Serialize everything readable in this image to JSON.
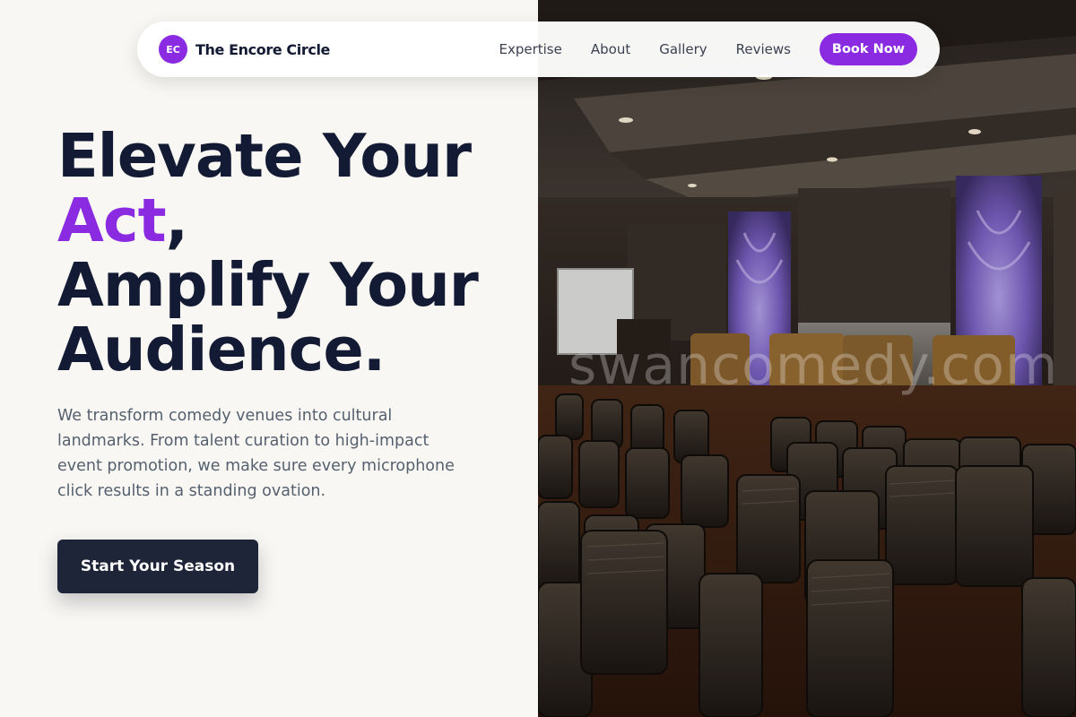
{
  "brand": {
    "initials": "EC",
    "name": "The Encore Circle",
    "accent_color": "#8a2be2"
  },
  "nav": {
    "links": [
      {
        "label": "Expertise"
      },
      {
        "label": "About"
      },
      {
        "label": "Gallery"
      },
      {
        "label": "Reviews"
      }
    ],
    "cta_label": "Book Now"
  },
  "hero": {
    "headline_line1": "Elevate Your",
    "headline_accent": "Act",
    "headline_comma": ",",
    "headline_line3": "Amplify Your",
    "headline_line4": "Audience.",
    "description": "We transform comedy venues into cultural landmarks. From talent curation to high-impact event promotion, we make sure every microphone click results in a standing ovation.",
    "cta_label": "Start Your Season",
    "image_watermark": "swancomedy.com"
  },
  "colors": {
    "heading": "#131a33",
    "accent": "#8a2be2",
    "body_text": "#55606f",
    "cta_bg": "#1e2538",
    "page_bg": "#f9f7f3"
  }
}
